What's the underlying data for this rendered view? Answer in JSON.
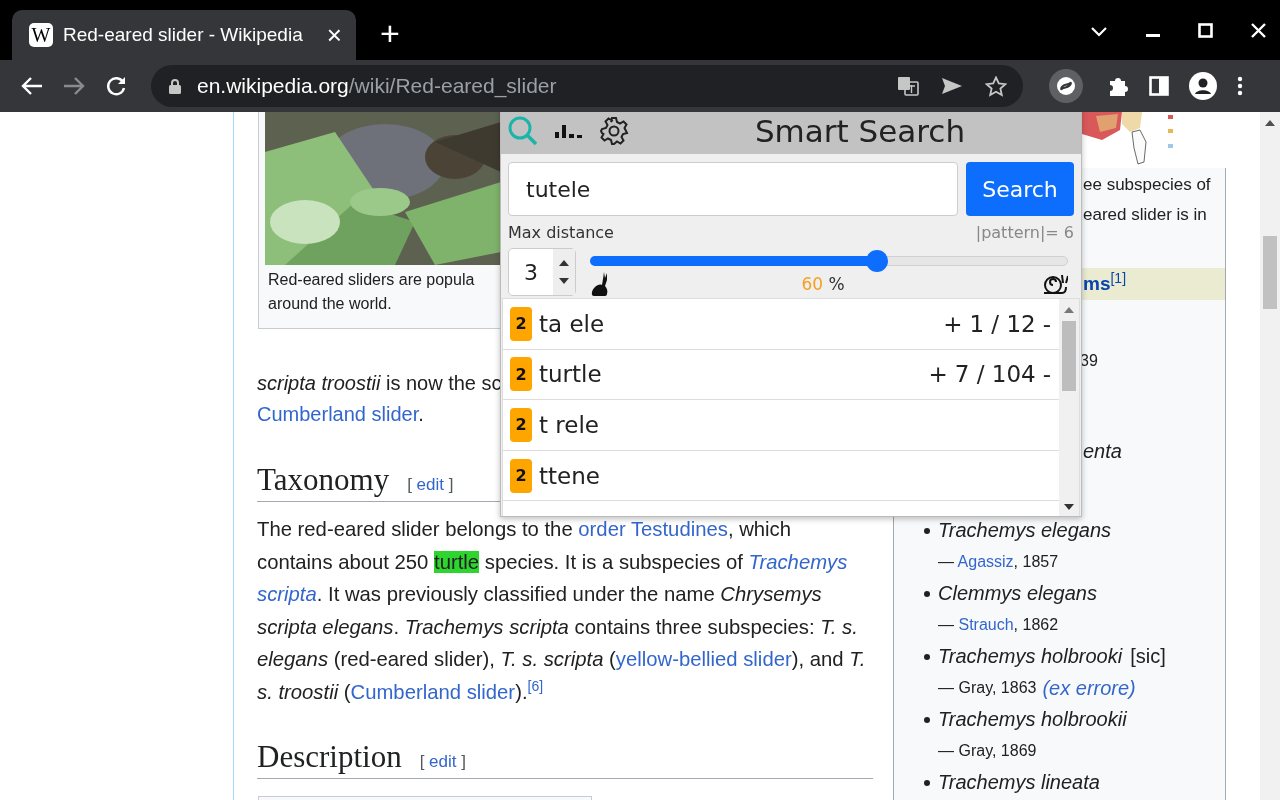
{
  "browser": {
    "tab": {
      "favicon": "W",
      "title": "Red-eared slider - Wikipedia",
      "close": "×"
    },
    "new_tab": "+",
    "url": {
      "host": "en.wikipedia.org",
      "path": "/wiki/Red-eared_slider"
    }
  },
  "article": {
    "figure": {
      "caption_lines": [
        "Red-eared sliders are popula",
        "around the world."
      ]
    },
    "intro_lines": [
      [
        {
          "kind": "italic",
          "t": "scripta troostii"
        },
        {
          "kind": "plain",
          "t": " is now the sc"
        }
      ],
      [
        {
          "kind": "link",
          "t": "Cumberland slider"
        },
        {
          "kind": "plain",
          "t": "."
        }
      ]
    ],
    "sections": [
      {
        "title": "Taxonomy",
        "edit": {
          "open": "[",
          "label": "edit",
          "close": "]"
        },
        "paragraph": [
          {
            "kind": "plain",
            "t": "The red-eared slider belongs to the "
          },
          {
            "kind": "link",
            "t": "order Testudines"
          },
          {
            "kind": "plain",
            "t": ", which contains about 250 "
          },
          {
            "kind": "highlight",
            "t": "turtle"
          },
          {
            "kind": "plain",
            "t": " species. It is a subspecies of "
          },
          {
            "kind": "link-italic",
            "t": "Trachemys "
          },
          {
            "kind": "link-italic",
            "t": "scripta"
          },
          {
            "kind": "plain",
            "t": ". It was previously classified under the name "
          },
          {
            "kind": "italic",
            "t": "Chrysemys scripta elegans"
          },
          {
            "kind": "plain",
            "t": ". "
          },
          {
            "kind": "italic",
            "t": "Trachemys scripta"
          },
          {
            "kind": "plain",
            "t": " contains three subspecies: "
          },
          {
            "kind": "italic",
            "t": "T. s. elegans"
          },
          {
            "kind": "plain",
            "t": " (red-eared slider), "
          },
          {
            "kind": "italic",
            "t": "T. s. scripta"
          },
          {
            "kind": "plain",
            "t": " ("
          },
          {
            "kind": "link",
            "t": "yellow-bellied slider"
          },
          {
            "kind": "plain",
            "t": "), and "
          },
          {
            "kind": "italic",
            "t": "T. s. troostii"
          },
          {
            "kind": "plain",
            "t": " ("
          },
          {
            "kind": "link",
            "t": "Cumberland slider"
          },
          {
            "kind": "plain",
            "t": ")."
          },
          {
            "kind": "ref",
            "t": "[6]"
          }
        ]
      },
      {
        "title": "Description",
        "edit": {
          "open": "[",
          "label": "edit",
          "close": "]"
        }
      }
    ]
  },
  "infobox": {
    "fragments": [
      "ee subspecies of",
      "eared slider is in"
    ],
    "section_heading": {
      "text": "ms",
      "ref": "[1]"
    },
    "fragment_year": "39",
    "fragment_name": "enta",
    "synonyms": [
      {
        "name": "Trachemys elegans",
        "dash": "—",
        "author": "Agassiz",
        "author_link": true,
        "year": ", 1857"
      },
      {
        "name": "Clemmys elegans",
        "dash": "—",
        "author": "Strauch",
        "author_link": true,
        "year": ", 1862"
      },
      {
        "name": "Trachemys holbrooki",
        "note": "[sic]",
        "dash": "—",
        "author": "Gray",
        "author_link": false,
        "year": ", 1863",
        "extra": "(ex errore)"
      },
      {
        "name": "Trachemys holbrookii",
        "dash": "—",
        "author": "Gray",
        "author_link": false,
        "year": ", 1869"
      },
      {
        "name": "Trachemys lineata"
      }
    ]
  },
  "popup": {
    "title": "Smart Search",
    "query": "tutele",
    "search_button": "Search",
    "distance_label": "Max distance",
    "pattern_length": "|pattern|= 6",
    "max_distance": "3",
    "slider": {
      "level": 0.6,
      "percent": "60",
      "unit": "%"
    },
    "results": [
      {
        "badge": "2",
        "text": "ta ele",
        "plus": "+",
        "count": "1 / 12",
        "minus": "-"
      },
      {
        "badge": "2",
        "text": "turtle",
        "plus": "+",
        "count": "7 / 104",
        "minus": "-"
      },
      {
        "badge": "2",
        "text": "t rele"
      },
      {
        "badge": "2",
        "text": "ttene"
      }
    ]
  }
}
